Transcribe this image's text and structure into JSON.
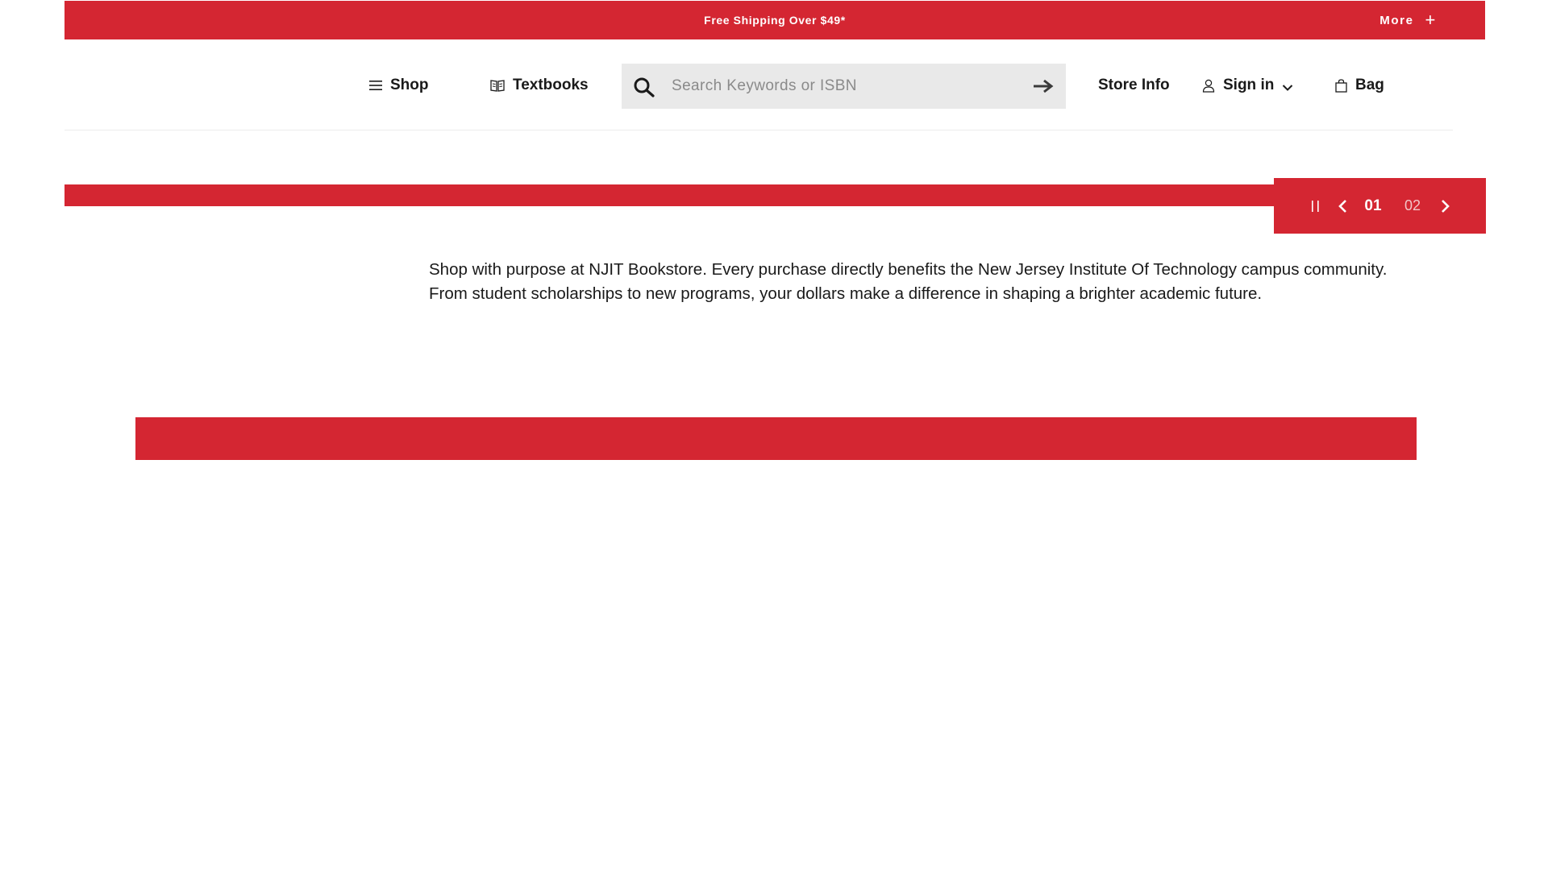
{
  "promo": {
    "text": "Free Shipping Over $49*",
    "more_label": "More",
    "more_icon": "plus-icon"
  },
  "nav": {
    "shop_label": "Shop",
    "shop_icon": "hamburger-menu-icon",
    "textbooks_label": "Textbooks",
    "textbooks_icon": "open-book-icon",
    "store_info_label": "Store Info",
    "sign_in_label": "Sign in",
    "sign_in_icon": "user-icon",
    "bag_label": "Bag",
    "bag_icon": "shopping-bag-icon"
  },
  "search": {
    "placeholder": "Search Keywords or ISBN",
    "value": ""
  },
  "carousel": {
    "current_slide": "01",
    "next_slide": "02"
  },
  "content": {
    "description": "Shop with purpose at NJIT Bookstore. Every purchase directly benefits the New Jersey Institute Of Technology campus community. From student scholarships to new programs, your dollars make a difference in shaping a brighter academic future."
  },
  "colors": {
    "brand_red": "#d42632",
    "search_bg": "#e9e9e9",
    "text": "#1a1a1a"
  }
}
